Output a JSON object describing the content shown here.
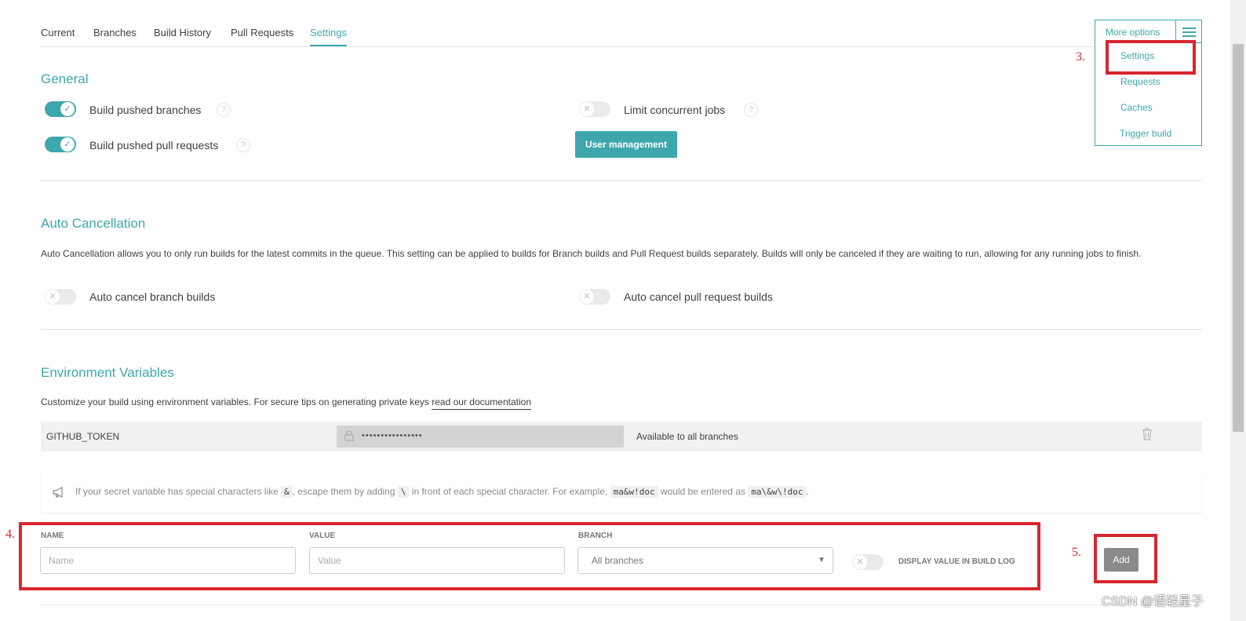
{
  "tabs": [
    "Current",
    "Branches",
    "Build History",
    "Pull Requests",
    "Settings"
  ],
  "more_options": {
    "label": "More options",
    "items": [
      "Settings",
      "Requests",
      "Caches",
      "Trigger build"
    ]
  },
  "annotations": [
    "3.",
    "4.",
    "5."
  ],
  "general": {
    "title": "General",
    "build_pushed_branches": "Build pushed branches",
    "build_pushed_prs": "Build pushed pull requests",
    "limit_concurrent": "Limit concurrent jobs",
    "user_management": "User management",
    "help": "?"
  },
  "auto_cancel": {
    "title": "Auto Cancellation",
    "description": "Auto Cancellation allows you to only run builds for the latest commits in the queue. This setting can be applied to builds for Branch builds and Pull Request builds separately. Builds will only be canceled if they are waiting to run, allowing for any running jobs to finish.",
    "branch": "Auto cancel branch builds",
    "pr": "Auto cancel pull request builds"
  },
  "env": {
    "title": "Environment Variables",
    "description": "Customize your build using environment variables. For secure tips on generating private keys ",
    "doc_link": "read our documentation",
    "row": {
      "name": "GITHUB_TOKEN",
      "value": "••••••••••••••••",
      "branch": "Available to all branches"
    },
    "notice": {
      "p1": "If your secret variable has special characters like ",
      "c1": "&",
      "p2": ", escape them by adding ",
      "c2": "\\",
      "p3": " in front of each special character. For example, ",
      "c3": "ma&w!doc",
      "p4": " would be entered as ",
      "c4": "ma\\&w\\!doc",
      "p5": "."
    },
    "form": {
      "name_label": "NAME",
      "value_label": "VALUE",
      "branch_label": "BRANCH",
      "name_placeholder": "Name",
      "value_placeholder": "Value",
      "branch_selected": "All branches",
      "display_label": "DISPLAY VALUE IN BUILD LOG",
      "add": "Add"
    }
  },
  "watermark": "CSDN @语轻星子",
  "colors": {
    "accent": "#3ea7ad",
    "annotation": "#d7262f"
  }
}
